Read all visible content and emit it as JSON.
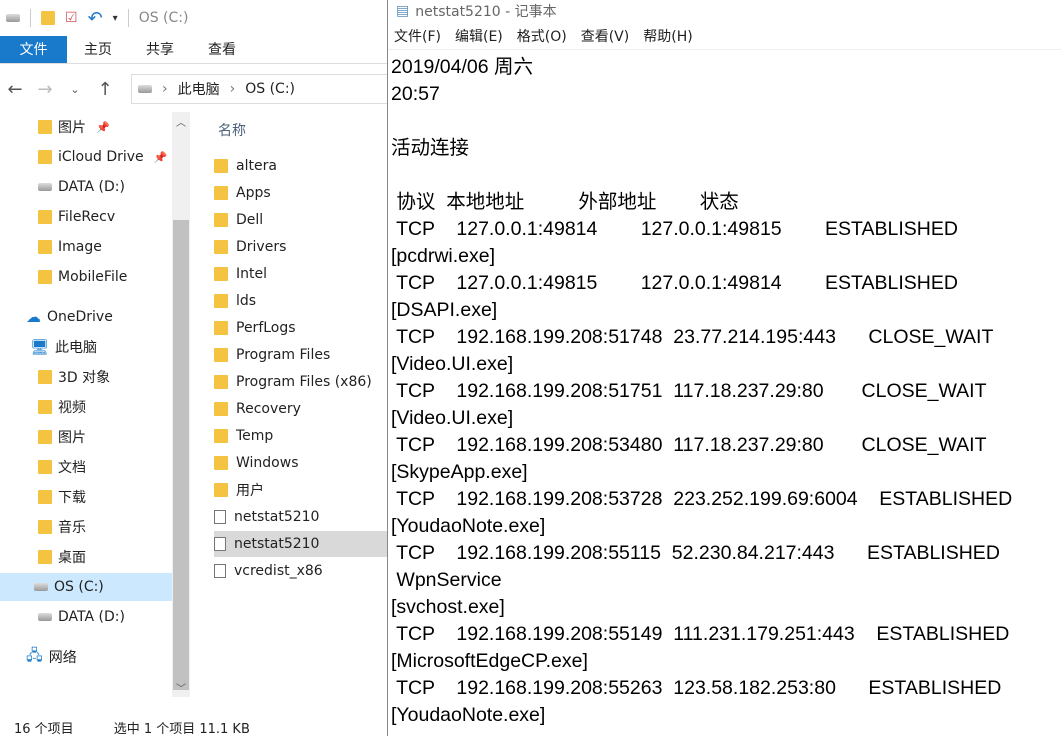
{
  "explorer": {
    "title": "OS (C:)",
    "ribbon_tabs": [
      "文件",
      "主页",
      "共享",
      "查看"
    ],
    "breadcrumb": [
      "此电脑",
      "OS (C:)"
    ],
    "tree": [
      {
        "label": "图片",
        "icon": "pictures-icon",
        "pinned": true
      },
      {
        "label": "iCloud Drive",
        "icon": "folder-icon",
        "pinned": true
      },
      {
        "label": "DATA (D:)",
        "icon": "drive-icon"
      },
      {
        "label": "FileRecv",
        "icon": "folder-icon"
      },
      {
        "label": "Image",
        "icon": "folder-icon"
      },
      {
        "label": "MobileFile",
        "icon": "folder-icon"
      },
      {
        "label": "OneDrive",
        "icon": "cloud-icon"
      },
      {
        "label": "此电脑",
        "icon": "computer-icon"
      },
      {
        "label": "3D 对象",
        "icon": "3d-objects-icon"
      },
      {
        "label": "视频",
        "icon": "videos-icon"
      },
      {
        "label": "图片",
        "icon": "pictures-icon"
      },
      {
        "label": "文档",
        "icon": "documents-icon"
      },
      {
        "label": "下载",
        "icon": "downloads-icon"
      },
      {
        "label": "音乐",
        "icon": "music-icon"
      },
      {
        "label": "桌面",
        "icon": "desktop-icon"
      },
      {
        "label": "OS (C:)",
        "icon": "drive-icon",
        "selected": true
      },
      {
        "label": "DATA (D:)",
        "icon": "drive-icon"
      },
      {
        "label": "网络",
        "icon": "network-icon"
      }
    ],
    "column_header": "名称",
    "files": [
      {
        "name": "altera",
        "type": "folder"
      },
      {
        "name": "Apps",
        "type": "folder"
      },
      {
        "name": "Dell",
        "type": "folder"
      },
      {
        "name": "Drivers",
        "type": "folder"
      },
      {
        "name": "Intel",
        "type": "folder"
      },
      {
        "name": "lds",
        "type": "folder"
      },
      {
        "name": "PerfLogs",
        "type": "folder"
      },
      {
        "name": "Program Files",
        "type": "folder"
      },
      {
        "name": "Program Files (x86)",
        "type": "folder"
      },
      {
        "name": "Recovery",
        "type": "folder"
      },
      {
        "name": "Temp",
        "type": "folder"
      },
      {
        "name": "Windows",
        "type": "folder"
      },
      {
        "name": "用户",
        "type": "folder"
      },
      {
        "name": "netstat5210",
        "type": "file"
      },
      {
        "name": "netstat5210",
        "type": "file",
        "selected": true
      },
      {
        "name": "vcredist_x86",
        "type": "file"
      }
    ],
    "status_count": "16 个项目",
    "status_selection": "选中 1 个项目  11.1 KB"
  },
  "notepad": {
    "title": "netstat5210 - 记事本",
    "menu": [
      "文件(F)",
      "编辑(E)",
      "格式(O)",
      "查看(V)",
      "帮助(H)"
    ],
    "lines": [
      "2019/04/06 周六",
      "20:57",
      "",
      "活动连接",
      "",
      " 协议  本地地址          外部地址        状态",
      " TCP    127.0.0.1:49814        127.0.0.1:49815        ESTABLISHED",
      "[pcdrwi.exe]",
      " TCP    127.0.0.1:49815        127.0.0.1:49814        ESTABLISHED",
      "[DSAPI.exe]",
      " TCP    192.168.199.208:51748  23.77.214.195:443      CLOSE_WAIT",
      "[Video.UI.exe]",
      " TCP    192.168.199.208:51751  117.18.237.29:80       CLOSE_WAIT",
      "[Video.UI.exe]",
      " TCP    192.168.199.208:53480  117.18.237.29:80       CLOSE_WAIT",
      "[SkypeApp.exe]",
      " TCP    192.168.199.208:53728  223.252.199.69:6004    ESTABLISHED",
      "[YoudaoNote.exe]",
      " TCP    192.168.199.208:55115  52.230.84.217:443      ESTABLISHED",
      " WpnService",
      "[svchost.exe]",
      " TCP    192.168.199.208:55149  111.231.179.251:443    ESTABLISHED",
      "[MicrosoftEdgeCP.exe]",
      " TCP    192.168.199.208:55263  123.58.182.253:80      ESTABLISHED",
      "[YoudaoNote.exe]"
    ]
  }
}
